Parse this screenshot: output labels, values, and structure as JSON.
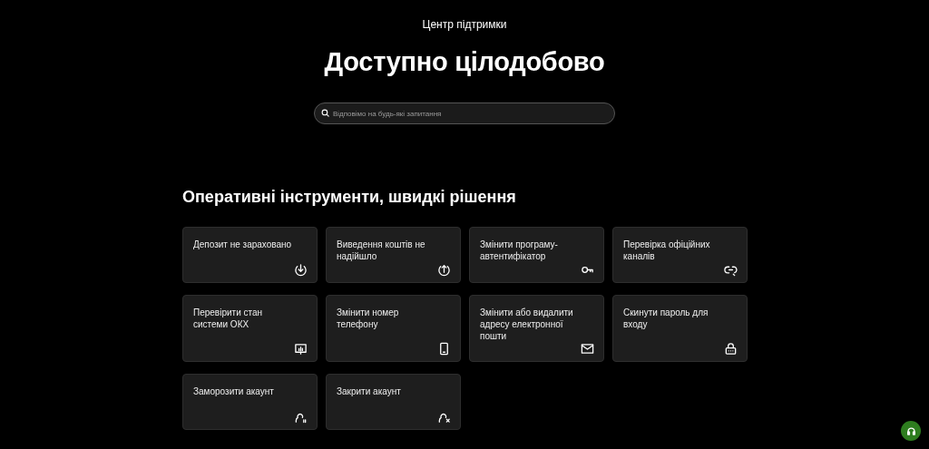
{
  "header": {
    "eyebrow": "Центр підтримки",
    "title": "Доступно цілодобово"
  },
  "search": {
    "placeholder": "Відповімо на будь-які запитання"
  },
  "section": {
    "title": "Оперативні інструменти, швидкі рішення"
  },
  "cards": [
    {
      "label": "Депозит не зараховано",
      "kind": "deposit"
    },
    {
      "label": "Виведення коштів не надійшло",
      "kind": "withdraw"
    },
    {
      "label": "Змінити програму-автентифікатор",
      "kind": "key"
    },
    {
      "label": "Перевірка офіційних каналів",
      "kind": "link"
    },
    {
      "label": "Перевірити стан системи ОКХ",
      "kind": "status"
    },
    {
      "label": "Змінити номер телефону",
      "kind": "phone"
    },
    {
      "label": "Змінити або видалити адресу електронної пошти",
      "kind": "mail"
    },
    {
      "label": "Скинути пароль для входу",
      "kind": "lock"
    },
    {
      "label": "Заморозити акаунт",
      "kind": "freeze"
    },
    {
      "label": "Закрити акаунт",
      "kind": "close"
    }
  ]
}
